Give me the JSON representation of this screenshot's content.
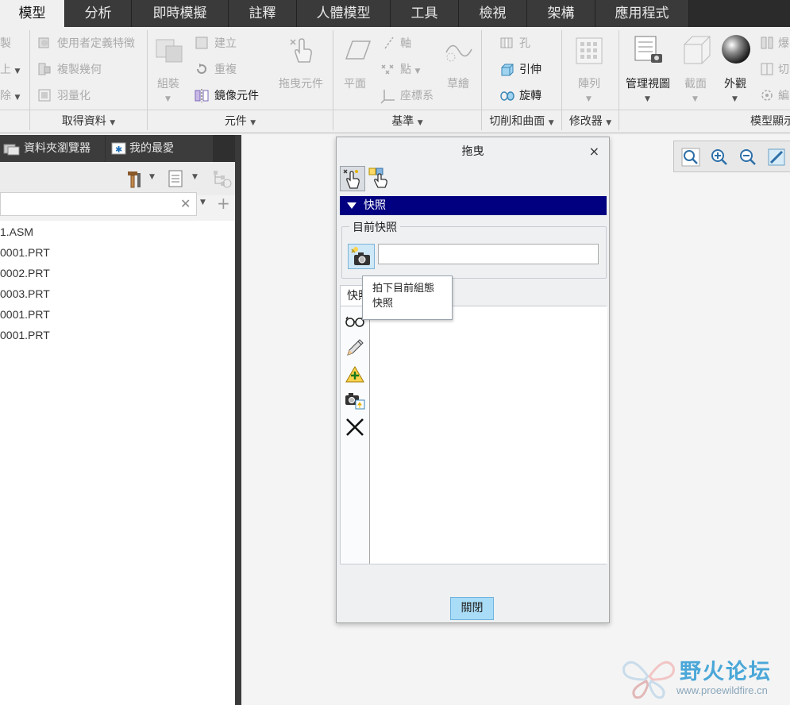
{
  "menu": {
    "tabs": [
      "模型",
      "分析",
      "即時模擬",
      "註釋",
      "人體模型",
      "工具",
      "檢視",
      "架構",
      "應用程式"
    ]
  },
  "ribbon": {
    "left_partial": [
      "製",
      "上",
      "除"
    ],
    "get_data": [
      "使用者定義特徵",
      "複製幾何",
      "羽量化"
    ],
    "component": {
      "assemble": "組裝",
      "create": "建立",
      "repeat": "重複",
      "mirror": "鏡像元件",
      "drag": "拖曳元件"
    },
    "datum": {
      "plane": "平面",
      "axis": "軸",
      "point": "點",
      "csys": "座標系",
      "sketch": "草繪"
    },
    "cut_surface": {
      "hole": "孔",
      "extrude": "引伸",
      "revolve": "旋轉"
    },
    "modifier": {
      "pattern": "陣列"
    },
    "model_display": {
      "manage_views": "管理視圖",
      "section": "截面",
      "appearance": "外觀",
      "partial1": "爆",
      "partial2": "切",
      "partial3": "編"
    },
    "groups": [
      "取得資料",
      "元件",
      "基準",
      "切削和曲面",
      "修改器",
      "模型顯示"
    ]
  },
  "left_panel": {
    "tabs": [
      "資料夾瀏覽器",
      "我的最愛"
    ],
    "tree_items": [
      "1.ASM",
      "0001.PRT",
      "0002.PRT",
      "0003.PRT",
      "0001.PRT",
      "0001.PRT"
    ]
  },
  "dialog": {
    "title": "拖曳",
    "close_x": "×",
    "section": "快照",
    "current_group": "目前快照",
    "snapshot_name_value": "",
    "tab_label": "快照",
    "tooltip_line1": "拍下目前組態",
    "tooltip_line2": "快照",
    "close_button": "關閉"
  },
  "watermark": {
    "title": "野火论坛",
    "url": "www.proewildfire.cn"
  },
  "colors": {
    "menubar": "#2b2b2b",
    "section_bar": "#000080",
    "accent_button": "#a9dcf6",
    "watermark": "#4aa7d8"
  }
}
